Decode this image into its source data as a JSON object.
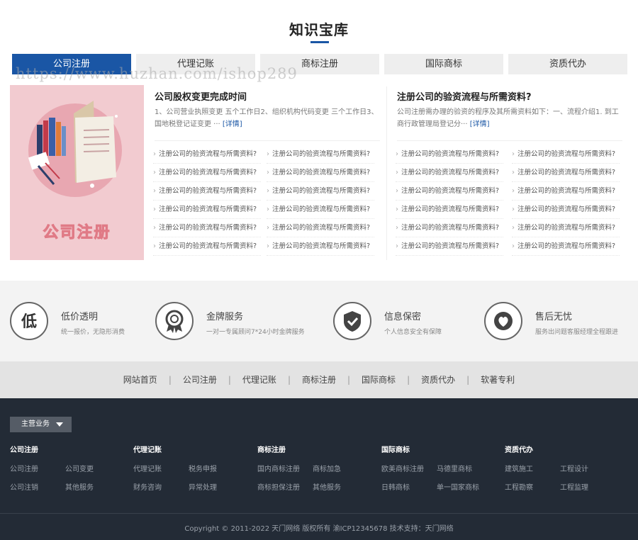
{
  "section": {
    "title": "知识宝库"
  },
  "watermark": "https://www.huzhan.com/ishop289",
  "tabs": [
    "公司注册",
    "代理记账",
    "商标注册",
    "国际商标",
    "资质代办"
  ],
  "banner": {
    "caption": "公司注册"
  },
  "left_article": {
    "title": "公司股权变更完成时间",
    "summary": "1、公司营业执照变更 五个工作日2、组织机构代码变更 三个工作日3、国地税登记证变更 ···",
    "more": "[详情]"
  },
  "right_article": {
    "title": "注册公司的验资流程与所需资料?",
    "summary": "公司注册需办理的验资的程序及其所需资料如下：一、流程介绍1. 到工商行政管理局登记分···",
    "more": "[详情]"
  },
  "link_text": "注册公司的验资流程与所需资料?",
  "features": [
    {
      "icon": "low-price-icon",
      "glyph": "低",
      "title": "低价透明",
      "desc": "统一报价，无隐形消费"
    },
    {
      "icon": "medal-icon",
      "glyph": "",
      "title": "金牌服务",
      "desc": "一对一专属顾问7*24小时金牌服务"
    },
    {
      "icon": "shield-check-icon",
      "glyph": "",
      "title": "信息保密",
      "desc": "个人信息安全有保障"
    },
    {
      "icon": "heart-icon",
      "glyph": "",
      "title": "售后无忧",
      "desc": "服务出问题客服经理全程跟进"
    }
  ],
  "nav": [
    "网站首页",
    "公司注册",
    "代理记账",
    "商标注册",
    "国际商标",
    "资质代办",
    "软著专利"
  ],
  "nav_divider": "|",
  "footer": {
    "dropdown": "主营业务",
    "columns": [
      {
        "title": "公司注册",
        "links": [
          "公司注册",
          "公司变更",
          "公司注销",
          "其他服务"
        ]
      },
      {
        "title": "代理记账",
        "links": [
          "代理记账",
          "税务申报",
          "财务咨询",
          "异常处理"
        ]
      },
      {
        "title": "商标注册",
        "links": [
          "国内商标注册",
          "商标加急",
          "商标担保注册",
          "其他服务"
        ]
      },
      {
        "title": "国际商标",
        "links": [
          "欧美商标注册",
          "马德里商标",
          "日韩商标",
          "单一国家商标"
        ]
      },
      {
        "title": "资质代办",
        "links": [
          "建筑施工",
          "工程设计",
          "工程勘察",
          "工程监理"
        ]
      }
    ],
    "copyright": "Copyright © 2011-2022 天门网络 版权所有 渝ICP12345678 技术支持：天门网络"
  },
  "colors": {
    "accent": "#1a56a5",
    "footer_bg": "#232b36",
    "banner_bg": "#f2cbd0"
  }
}
